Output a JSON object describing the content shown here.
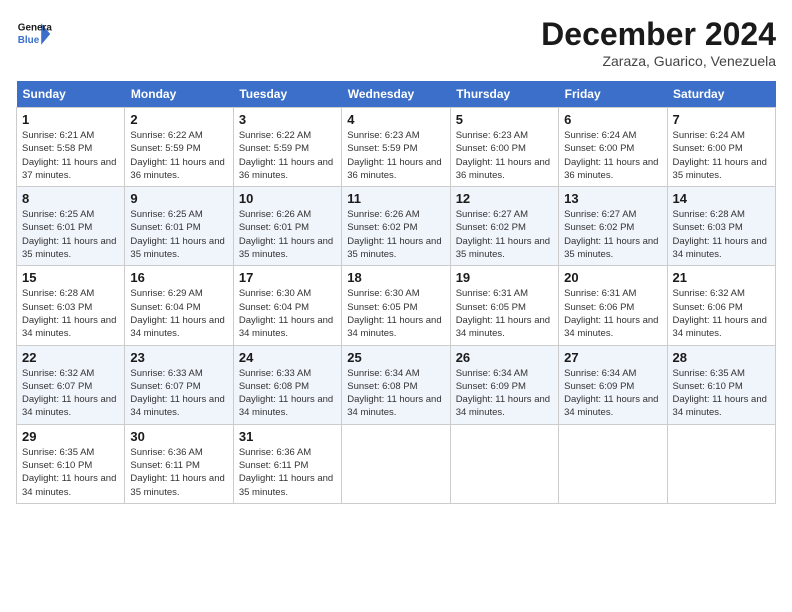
{
  "header": {
    "logo_line1": "General",
    "logo_line2": "Blue",
    "month_title": "December 2024",
    "location": "Zaraza, Guarico, Venezuela"
  },
  "weekdays": [
    "Sunday",
    "Monday",
    "Tuesday",
    "Wednesday",
    "Thursday",
    "Friday",
    "Saturday"
  ],
  "weeks": [
    [
      {
        "day": "1",
        "sunrise": "6:21 AM",
        "sunset": "5:58 PM",
        "daylight": "11 hours and 37 minutes."
      },
      {
        "day": "2",
        "sunrise": "6:22 AM",
        "sunset": "5:59 PM",
        "daylight": "11 hours and 36 minutes."
      },
      {
        "day": "3",
        "sunrise": "6:22 AM",
        "sunset": "5:59 PM",
        "daylight": "11 hours and 36 minutes."
      },
      {
        "day": "4",
        "sunrise": "6:23 AM",
        "sunset": "5:59 PM",
        "daylight": "11 hours and 36 minutes."
      },
      {
        "day": "5",
        "sunrise": "6:23 AM",
        "sunset": "6:00 PM",
        "daylight": "11 hours and 36 minutes."
      },
      {
        "day": "6",
        "sunrise": "6:24 AM",
        "sunset": "6:00 PM",
        "daylight": "11 hours and 36 minutes."
      },
      {
        "day": "7",
        "sunrise": "6:24 AM",
        "sunset": "6:00 PM",
        "daylight": "11 hours and 35 minutes."
      }
    ],
    [
      {
        "day": "8",
        "sunrise": "6:25 AM",
        "sunset": "6:01 PM",
        "daylight": "11 hours and 35 minutes."
      },
      {
        "day": "9",
        "sunrise": "6:25 AM",
        "sunset": "6:01 PM",
        "daylight": "11 hours and 35 minutes."
      },
      {
        "day": "10",
        "sunrise": "6:26 AM",
        "sunset": "6:01 PM",
        "daylight": "11 hours and 35 minutes."
      },
      {
        "day": "11",
        "sunrise": "6:26 AM",
        "sunset": "6:02 PM",
        "daylight": "11 hours and 35 minutes."
      },
      {
        "day": "12",
        "sunrise": "6:27 AM",
        "sunset": "6:02 PM",
        "daylight": "11 hours and 35 minutes."
      },
      {
        "day": "13",
        "sunrise": "6:27 AM",
        "sunset": "6:02 PM",
        "daylight": "11 hours and 35 minutes."
      },
      {
        "day": "14",
        "sunrise": "6:28 AM",
        "sunset": "6:03 PM",
        "daylight": "11 hours and 34 minutes."
      }
    ],
    [
      {
        "day": "15",
        "sunrise": "6:28 AM",
        "sunset": "6:03 PM",
        "daylight": "11 hours and 34 minutes."
      },
      {
        "day": "16",
        "sunrise": "6:29 AM",
        "sunset": "6:04 PM",
        "daylight": "11 hours and 34 minutes."
      },
      {
        "day": "17",
        "sunrise": "6:30 AM",
        "sunset": "6:04 PM",
        "daylight": "11 hours and 34 minutes."
      },
      {
        "day": "18",
        "sunrise": "6:30 AM",
        "sunset": "6:05 PM",
        "daylight": "11 hours and 34 minutes."
      },
      {
        "day": "19",
        "sunrise": "6:31 AM",
        "sunset": "6:05 PM",
        "daylight": "11 hours and 34 minutes."
      },
      {
        "day": "20",
        "sunrise": "6:31 AM",
        "sunset": "6:06 PM",
        "daylight": "11 hours and 34 minutes."
      },
      {
        "day": "21",
        "sunrise": "6:32 AM",
        "sunset": "6:06 PM",
        "daylight": "11 hours and 34 minutes."
      }
    ],
    [
      {
        "day": "22",
        "sunrise": "6:32 AM",
        "sunset": "6:07 PM",
        "daylight": "11 hours and 34 minutes."
      },
      {
        "day": "23",
        "sunrise": "6:33 AM",
        "sunset": "6:07 PM",
        "daylight": "11 hours and 34 minutes."
      },
      {
        "day": "24",
        "sunrise": "6:33 AM",
        "sunset": "6:08 PM",
        "daylight": "11 hours and 34 minutes."
      },
      {
        "day": "25",
        "sunrise": "6:34 AM",
        "sunset": "6:08 PM",
        "daylight": "11 hours and 34 minutes."
      },
      {
        "day": "26",
        "sunrise": "6:34 AM",
        "sunset": "6:09 PM",
        "daylight": "11 hours and 34 minutes."
      },
      {
        "day": "27",
        "sunrise": "6:34 AM",
        "sunset": "6:09 PM",
        "daylight": "11 hours and 34 minutes."
      },
      {
        "day": "28",
        "sunrise": "6:35 AM",
        "sunset": "6:10 PM",
        "daylight": "11 hours and 34 minutes."
      }
    ],
    [
      {
        "day": "29",
        "sunrise": "6:35 AM",
        "sunset": "6:10 PM",
        "daylight": "11 hours and 34 minutes."
      },
      {
        "day": "30",
        "sunrise": "6:36 AM",
        "sunset": "6:11 PM",
        "daylight": "11 hours and 35 minutes."
      },
      {
        "day": "31",
        "sunrise": "6:36 AM",
        "sunset": "6:11 PM",
        "daylight": "11 hours and 35 minutes."
      },
      null,
      null,
      null,
      null
    ]
  ]
}
